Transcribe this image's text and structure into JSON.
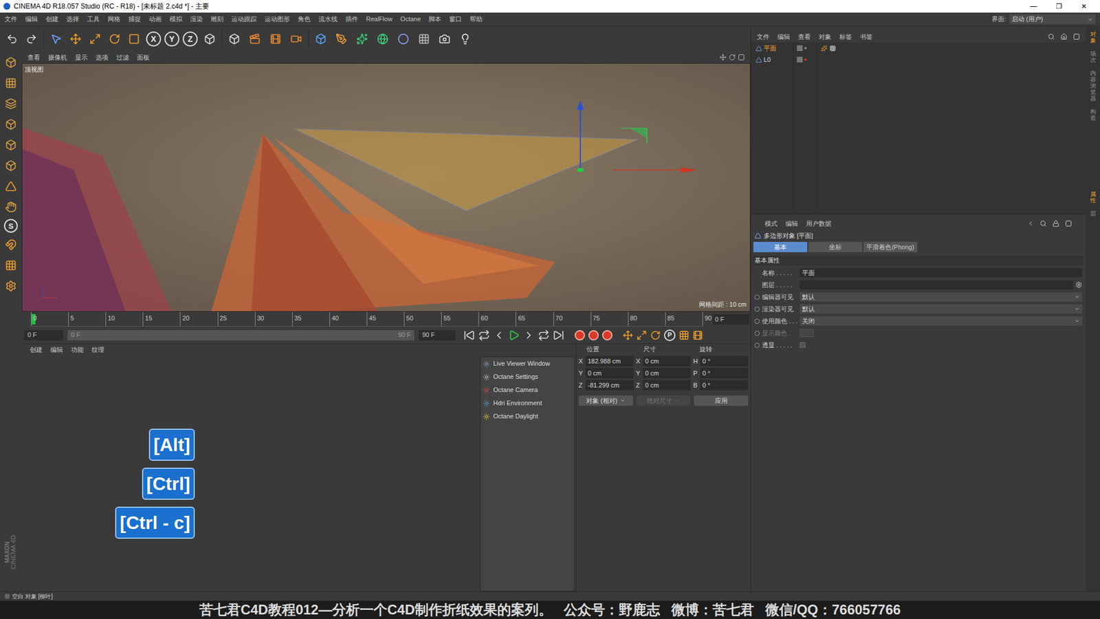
{
  "window": {
    "title": "CINEMA 4D R18.057 Studio (RC - R18) - [未标题 2.c4d *] - 主要",
    "controls": [
      "—",
      "❐",
      "✕"
    ]
  },
  "menu": [
    "文件",
    "编辑",
    "创建",
    "选择",
    "工具",
    "网格",
    "捕捉",
    "动画",
    "模拟",
    "渲染",
    "雕刻",
    "运动跟踪",
    "运动图形",
    "角色",
    "流水线",
    "插件",
    "RealFlow",
    "Octane",
    "脚本",
    "窗口",
    "帮助"
  ],
  "layout": {
    "label": "界面:",
    "value": "启动 (用户)"
  },
  "toolbar": {
    "axis_buttons": [
      "X",
      "Y",
      "Z"
    ]
  },
  "left_tools": {
    "glyph": "S"
  },
  "logo": [
    "MAXON",
    "CINEMA 4D"
  ],
  "viewport": {
    "menu": [
      "查看",
      "摄像机",
      "显示",
      "选项",
      "过滤",
      "面板"
    ],
    "view_name": "顶视图",
    "grid_spacing": "网格间距 : 10 cm"
  },
  "timeline": {
    "ticks": [
      "0",
      "5",
      "10",
      "15",
      "20",
      "25",
      "30",
      "35",
      "40",
      "45",
      "50",
      "55",
      "60",
      "65",
      "70",
      "75",
      "80",
      "85",
      "90"
    ],
    "current_frame": "0 F",
    "start": "0 F",
    "slider_start": "0 F",
    "slider_end": "90 F",
    "end": "90 F",
    "playhead_level": 0,
    "key_button": "P"
  },
  "material_manager": {
    "menu": [
      "创建",
      "编辑",
      "功能",
      "纹理"
    ],
    "octane_menu": [
      "Live Viewer Window",
      "Octane Settings",
      "Octane Camera",
      "Hdri Environment",
      "Octane Daylight"
    ]
  },
  "coordinates": {
    "headers": [
      "位置",
      "尺寸",
      "旋转"
    ],
    "rows": [
      {
        "axis": "X",
        "position": "182.988 cm",
        "size_axis": "X",
        "size": "0 cm",
        "rot_axis": "H",
        "rotation": "0 °"
      },
      {
        "axis": "Y",
        "position": "0 cm",
        "size_axis": "Y",
        "size": "0 cm",
        "rot_axis": "P",
        "rotation": "0 °"
      },
      {
        "axis": "Z",
        "position": "-81.299 cm",
        "size_axis": "Z",
        "size": "0 cm",
        "rot_axis": "B",
        "rotation": "0 °"
      }
    ],
    "mode": "对象 (相对)",
    "size_mode": {
      "label": "绝对尺寸",
      "disabled": true
    },
    "apply": "应用"
  },
  "object_manager": {
    "menu": [
      "文件",
      "编辑",
      "查看",
      "对象",
      "标签",
      "书签"
    ],
    "objects": [
      {
        "name": "平面",
        "selected": true
      },
      {
        "name": "L0",
        "selected": false
      }
    ]
  },
  "attribute_manager": {
    "menu": [
      "模式",
      "编辑",
      "用户数据"
    ],
    "title": "多边形对象 [平面]",
    "tabs": [
      {
        "label": "基本",
        "selected": true
      },
      {
        "label": "坐标",
        "selected": false
      },
      {
        "label": "平滑着色(Phong)",
        "selected": false
      }
    ],
    "section": "基本属性",
    "fields": [
      {
        "label": "名称 . . . . .",
        "kind": "text",
        "value": "平面",
        "disabled": false
      },
      {
        "label": "图层 . . . . .",
        "kind": "link",
        "value": "",
        "disabled": false
      },
      {
        "label": "编辑器可见",
        "kind": "select",
        "value": "默认",
        "disabled": false
      },
      {
        "label": "渲染器可见",
        "kind": "select",
        "value": "默认",
        "disabled": false
      },
      {
        "label": "使用颜色 . . .",
        "kind": "select",
        "value": "关闭",
        "disabled": false
      },
      {
        "label": "显示颜色 .",
        "kind": "color",
        "value": "",
        "disabled": true
      },
      {
        "label": "透显 . . . . .",
        "kind": "checkbox",
        "value": "",
        "checked": false,
        "disabled": false
      }
    ]
  },
  "side_tabs": [
    {
      "label": "对象",
      "selected": true
    },
    {
      "label": "场次",
      "selected": false
    },
    {
      "label": "内容浏览器",
      "selected": false
    },
    {
      "label": "构造",
      "selected": false
    },
    {
      "label": "属性",
      "selected": true
    },
    {
      "label": "层",
      "selected": false
    }
  ],
  "status": "空白 对象 [柳叶]",
  "subtitle": "苦七君C4D教程012—分析一个C4D制作折纸效果的案列。   公众号：野鹿志   微博：苦七君   微信/QQ：766057766",
  "key_overlays": [
    "[Alt]",
    "[Ctrl]",
    "[Ctrl - c]"
  ]
}
